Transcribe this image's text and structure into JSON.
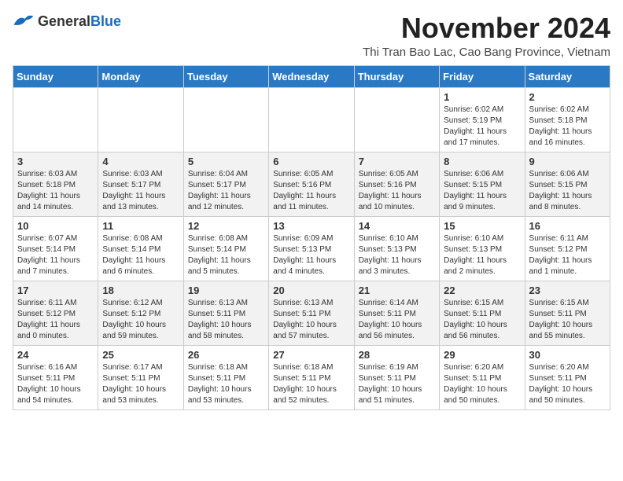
{
  "header": {
    "logo_general": "General",
    "logo_blue": "Blue",
    "month_title": "November 2024",
    "subtitle": "Thi Tran Bao Lac, Cao Bang Province, Vietnam"
  },
  "weekdays": [
    "Sunday",
    "Monday",
    "Tuesday",
    "Wednesday",
    "Thursday",
    "Friday",
    "Saturday"
  ],
  "weeks": [
    [
      {
        "day": "",
        "info": ""
      },
      {
        "day": "",
        "info": ""
      },
      {
        "day": "",
        "info": ""
      },
      {
        "day": "",
        "info": ""
      },
      {
        "day": "",
        "info": ""
      },
      {
        "day": "1",
        "info": "Sunrise: 6:02 AM\nSunset: 5:19 PM\nDaylight: 11 hours and 17 minutes."
      },
      {
        "day": "2",
        "info": "Sunrise: 6:02 AM\nSunset: 5:18 PM\nDaylight: 11 hours and 16 minutes."
      }
    ],
    [
      {
        "day": "3",
        "info": "Sunrise: 6:03 AM\nSunset: 5:18 PM\nDaylight: 11 hours and 14 minutes."
      },
      {
        "day": "4",
        "info": "Sunrise: 6:03 AM\nSunset: 5:17 PM\nDaylight: 11 hours and 13 minutes."
      },
      {
        "day": "5",
        "info": "Sunrise: 6:04 AM\nSunset: 5:17 PM\nDaylight: 11 hours and 12 minutes."
      },
      {
        "day": "6",
        "info": "Sunrise: 6:05 AM\nSunset: 5:16 PM\nDaylight: 11 hours and 11 minutes."
      },
      {
        "day": "7",
        "info": "Sunrise: 6:05 AM\nSunset: 5:16 PM\nDaylight: 11 hours and 10 minutes."
      },
      {
        "day": "8",
        "info": "Sunrise: 6:06 AM\nSunset: 5:15 PM\nDaylight: 11 hours and 9 minutes."
      },
      {
        "day": "9",
        "info": "Sunrise: 6:06 AM\nSunset: 5:15 PM\nDaylight: 11 hours and 8 minutes."
      }
    ],
    [
      {
        "day": "10",
        "info": "Sunrise: 6:07 AM\nSunset: 5:14 PM\nDaylight: 11 hours and 7 minutes."
      },
      {
        "day": "11",
        "info": "Sunrise: 6:08 AM\nSunset: 5:14 PM\nDaylight: 11 hours and 6 minutes."
      },
      {
        "day": "12",
        "info": "Sunrise: 6:08 AM\nSunset: 5:14 PM\nDaylight: 11 hours and 5 minutes."
      },
      {
        "day": "13",
        "info": "Sunrise: 6:09 AM\nSunset: 5:13 PM\nDaylight: 11 hours and 4 minutes."
      },
      {
        "day": "14",
        "info": "Sunrise: 6:10 AM\nSunset: 5:13 PM\nDaylight: 11 hours and 3 minutes."
      },
      {
        "day": "15",
        "info": "Sunrise: 6:10 AM\nSunset: 5:13 PM\nDaylight: 11 hours and 2 minutes."
      },
      {
        "day": "16",
        "info": "Sunrise: 6:11 AM\nSunset: 5:12 PM\nDaylight: 11 hours and 1 minute."
      }
    ],
    [
      {
        "day": "17",
        "info": "Sunrise: 6:11 AM\nSunset: 5:12 PM\nDaylight: 11 hours and 0 minutes."
      },
      {
        "day": "18",
        "info": "Sunrise: 6:12 AM\nSunset: 5:12 PM\nDaylight: 10 hours and 59 minutes."
      },
      {
        "day": "19",
        "info": "Sunrise: 6:13 AM\nSunset: 5:11 PM\nDaylight: 10 hours and 58 minutes."
      },
      {
        "day": "20",
        "info": "Sunrise: 6:13 AM\nSunset: 5:11 PM\nDaylight: 10 hours and 57 minutes."
      },
      {
        "day": "21",
        "info": "Sunrise: 6:14 AM\nSunset: 5:11 PM\nDaylight: 10 hours and 56 minutes."
      },
      {
        "day": "22",
        "info": "Sunrise: 6:15 AM\nSunset: 5:11 PM\nDaylight: 10 hours and 56 minutes."
      },
      {
        "day": "23",
        "info": "Sunrise: 6:15 AM\nSunset: 5:11 PM\nDaylight: 10 hours and 55 minutes."
      }
    ],
    [
      {
        "day": "24",
        "info": "Sunrise: 6:16 AM\nSunset: 5:11 PM\nDaylight: 10 hours and 54 minutes."
      },
      {
        "day": "25",
        "info": "Sunrise: 6:17 AM\nSunset: 5:11 PM\nDaylight: 10 hours and 53 minutes."
      },
      {
        "day": "26",
        "info": "Sunrise: 6:18 AM\nSunset: 5:11 PM\nDaylight: 10 hours and 53 minutes."
      },
      {
        "day": "27",
        "info": "Sunrise: 6:18 AM\nSunset: 5:11 PM\nDaylight: 10 hours and 52 minutes."
      },
      {
        "day": "28",
        "info": "Sunrise: 6:19 AM\nSunset: 5:11 PM\nDaylight: 10 hours and 51 minutes."
      },
      {
        "day": "29",
        "info": "Sunrise: 6:20 AM\nSunset: 5:11 PM\nDaylight: 10 hours and 50 minutes."
      },
      {
        "day": "30",
        "info": "Sunrise: 6:20 AM\nSunset: 5:11 PM\nDaylight: 10 hours and 50 minutes."
      }
    ]
  ]
}
